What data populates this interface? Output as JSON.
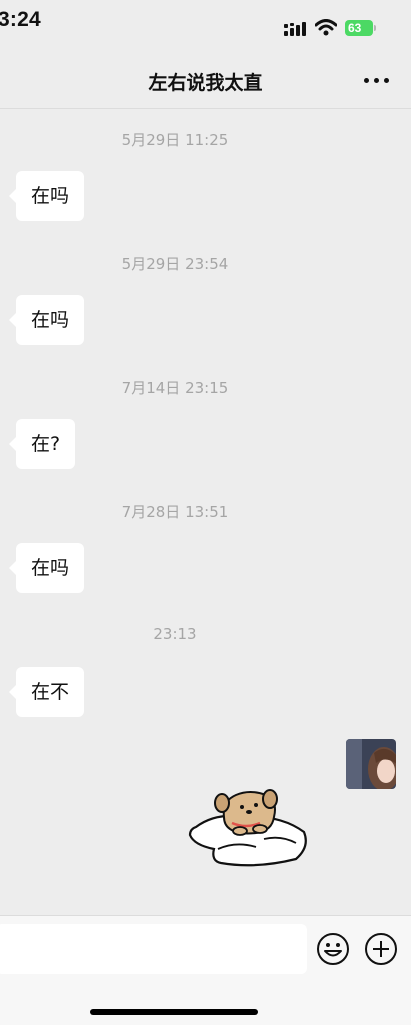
{
  "status_bar": {
    "time": "3:24",
    "battery_level": "63",
    "icons": [
      "signal-icon",
      "wifi-icon",
      "battery-icon"
    ]
  },
  "header": {
    "title": "左右说我太直",
    "more_icon": "more-icon"
  },
  "messages": [
    {
      "timestamp": "5月29日 11:25",
      "text": "在吗"
    },
    {
      "timestamp": "5月29日 23:54",
      "text": "在吗"
    },
    {
      "timestamp": "7月14日 23:15",
      "text": "在?"
    },
    {
      "timestamp": "7月28日 13:51",
      "text": "在吗"
    },
    {
      "timestamp": "23:13",
      "text": "在不"
    }
  ],
  "sent_sticker": {
    "icon": "dog-sticker-icon"
  },
  "input_bar": {
    "value": "",
    "emoji_icon": "emoji-icon",
    "plus_icon": "plus-icon"
  },
  "colors": {
    "background": "#ededed",
    "bubble": "#ffffff",
    "timestamp": "#a5a5a5",
    "battery": "#4cd964"
  }
}
